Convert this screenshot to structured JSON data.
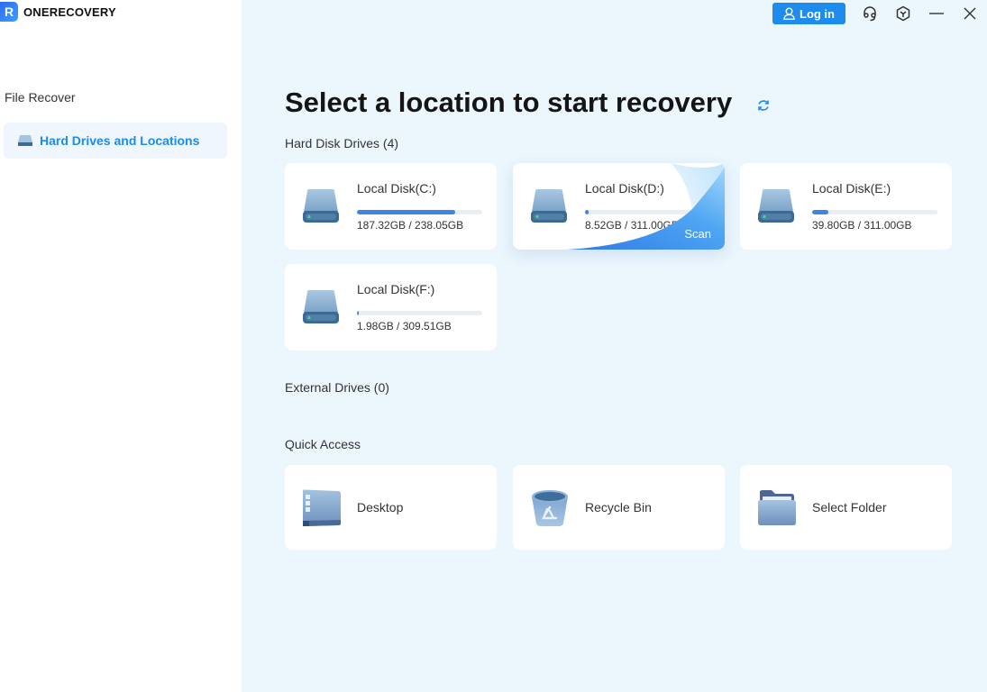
{
  "app": {
    "name": "ONERECOVERY",
    "logo_letter": "R"
  },
  "sidebar": {
    "section": "File Recover",
    "items": [
      {
        "label": "Hard Drives and Locations",
        "active": true,
        "icon": "drive-icon"
      }
    ]
  },
  "topbar": {
    "login_label": "Log in",
    "icons": [
      "user-icon",
      "support-headset-icon",
      "cube-icon",
      "minimize-icon",
      "close-icon"
    ]
  },
  "main": {
    "title": "Select a location to start recovery",
    "refresh_icon": "refresh-icon",
    "hard_disks": {
      "label": "Hard Disk Drives (4)",
      "drives": [
        {
          "name": "Local Disk(C:)",
          "size": "187.32GB / 238.05GB",
          "used_fraction": 0.787
        },
        {
          "name": "Local Disk(D:)",
          "size": "8.52GB / 311.00GB",
          "used_fraction": 0.027,
          "hover_action": "Scan"
        },
        {
          "name": "Local Disk(E:)",
          "size": "39.80GB / 311.00GB",
          "used_fraction": 0.128
        },
        {
          "name": "Local Disk(F:)",
          "size": "1.98GB / 309.51GB",
          "used_fraction": 0.0064
        }
      ]
    },
    "external": {
      "label": "External Drives (0)"
    },
    "quick_access": {
      "label": "Quick Access",
      "items": [
        {
          "name": "Desktop",
          "icon": "desktop-icon"
        },
        {
          "name": "Recycle Bin",
          "icon": "recycle-bin-icon"
        },
        {
          "name": "Select Folder",
          "icon": "folder-icon"
        }
      ]
    }
  },
  "colors": {
    "accent": "#1e8bef",
    "progress": "#3d84e4",
    "background": "#ebf6fd"
  }
}
